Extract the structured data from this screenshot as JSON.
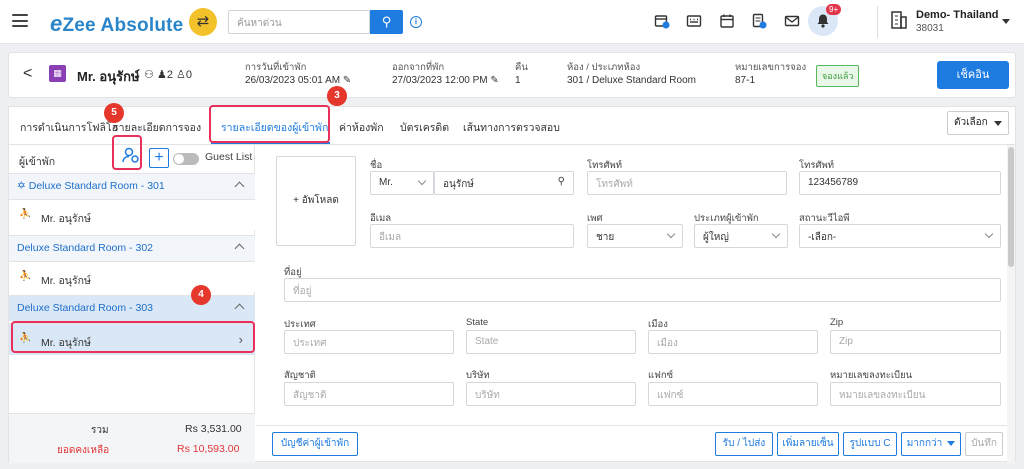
{
  "topbar": {
    "logo_mark": "e",
    "logo_text": "Zee Absolute",
    "search_placeholder": "ค้นหาด่วน",
    "notification_count": "9+",
    "property_name": "Demo- Thailand",
    "property_id": "38031",
    "icons": [
      "calendar-plus-icon",
      "keyboard-icon",
      "calendar-icon",
      "document-icon",
      "mail-icon",
      "bell-icon",
      "building-icon"
    ]
  },
  "booking": {
    "guest_name": "Mr. อนุรักษ์",
    "adults": "2",
    "children": "0",
    "arrival_label": "การวันที่เข้าพัก",
    "arrival_value": "26/03/2023 05:01 AM",
    "departure_label": "ออกจากที่พัก",
    "departure_value": "27/03/2023 12:00 PM",
    "nights_label": "คืน",
    "nights_value": "1",
    "room_label": "ห้อง / ประเภทห้อง",
    "room_value": "301 / Deluxe Standard Room",
    "reservation_label": "หมายเลขการจอง",
    "reservation_value": "87-1",
    "status": "จองแล้ว",
    "checkout_button": "เช็คอิน"
  },
  "tabs": [
    {
      "label": "การดำเนินการโฟลิโอ"
    },
    {
      "label": "รายละเอียดการจอง"
    },
    {
      "label": "รายละเอียดของผู้เข้าพัก"
    },
    {
      "label": "ค่าห้องพัก"
    },
    {
      "label": "บัตรเครดิต"
    },
    {
      "label": "เส้นทางการตรวจสอบ"
    }
  ],
  "options_label": "ตัวเลือก",
  "guest_panel": {
    "header": "ผู้เข้าพัก",
    "guest_list_label": "Guest List",
    "rooms": [
      {
        "name": "Deluxe Standard Room - 301",
        "guest": "Mr. อนุรักษ์"
      },
      {
        "name": "Deluxe Standard Room - 302",
        "guest": "Mr. อนุรักษ์"
      },
      {
        "name": "Deluxe Standard Room - 303",
        "guest": "Mr. อนุรักษ์"
      }
    ],
    "total_label": "รวม",
    "total_value": "Rs 3,531.00",
    "balance_label": "ยอดคงเหลือ",
    "balance_value": "Rs 10,593.00"
  },
  "form": {
    "upload_label": "+ อัพโหลด",
    "name_label": "ชื่อ",
    "title_value": "Mr.",
    "name_value": "อนุรักษ์",
    "phone_label": "โทรศัพท์",
    "phone_placeholder": "โทรศัพท์",
    "mobile_label": "โทรศัพท์",
    "mobile_value": "123456789",
    "email_label": "อีเมล",
    "email_placeholder": "อีเมล",
    "gender_label": "เพศ",
    "gender_value": "ชาย",
    "guest_type_label": "ประเภทผู้เข้าพัก",
    "guest_type_value": "ผู้ใหญ่",
    "vip_label": "สถานะวีไอพี",
    "vip_value": "-เลือก-",
    "address_label": "ที่อยู่",
    "address_placeholder": "ที่อยู่",
    "country_label": "ประเทศ",
    "country_placeholder": "ประเทศ",
    "state_label": "State",
    "state_placeholder": "State",
    "city_label": "เมือง",
    "city_placeholder": "เมือง",
    "zip_label": "Zip",
    "zip_placeholder": "Zip",
    "nationality_label": "สัญชาติ",
    "nationality_placeholder": "สัญชาติ",
    "company_label": "บริษัท",
    "company_placeholder": "บริษัท",
    "fax_label": "แฟกซ์",
    "fax_placeholder": "แฟกซ์",
    "reg_no_label": "หมายเลขลงทะเบียน",
    "reg_no_placeholder": "หมายเลขลงทะเบียน"
  },
  "footer": {
    "guest_account": "บัญชีค่าผู้เข้าพัก",
    "pickup_drop": "รับ / ไปส่ง",
    "add_more": "เพิ่มลายเซ็น",
    "photo": "รูปแบบ C",
    "more": "มากกว่า",
    "save": "บันทึก"
  },
  "annotations": [
    "5",
    "3",
    "4"
  ],
  "colors": {
    "accent": "#1e7be0",
    "highlight": "#e8305a",
    "marker": "#e5372b"
  }
}
